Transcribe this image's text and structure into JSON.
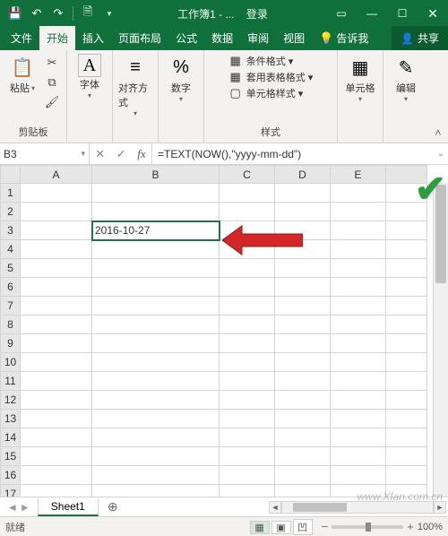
{
  "titlebar": {
    "doc_title": "工作簿1 - ...",
    "login": "登录"
  },
  "tabs": {
    "file": "文件",
    "home": "开始",
    "insert": "插入",
    "layout": "页面布局",
    "formulas": "公式",
    "data": "数据",
    "review": "审阅",
    "view": "视图",
    "tell_me": "告诉我",
    "share": "共享"
  },
  "ribbon": {
    "clipboard": {
      "paste": "粘贴",
      "group": "剪贴板"
    },
    "font": {
      "btn": "字体",
      "group": "字体"
    },
    "align": {
      "btn": "对齐方式"
    },
    "number": {
      "btn": "数字"
    },
    "styles": {
      "cond": "条件格式 ▾",
      "table": "套用表格格式 ▾",
      "cell": "单元格样式 ▾",
      "group": "样式"
    },
    "cells": {
      "btn": "单元格"
    },
    "editing": {
      "btn": "编辑"
    }
  },
  "formula_bar": {
    "cell_ref": "B3",
    "formula": "=TEXT(NOW(),\"yyyy-mm-dd\")"
  },
  "columns": [
    "A",
    "B",
    "C",
    "D",
    "E"
  ],
  "cell_value": "2016-10-27",
  "sheet": {
    "name": "Sheet1"
  },
  "status": {
    "ready": "就绪",
    "zoom": "100%"
  },
  "watermark": "www.Xfan.com.cn"
}
